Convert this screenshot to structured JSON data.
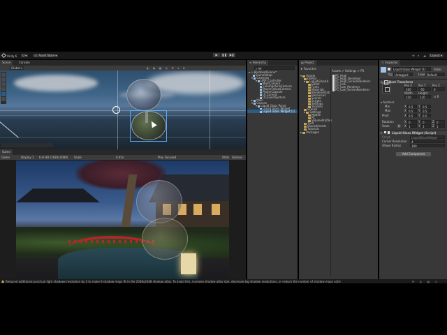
{
  "menubar": {
    "unity_label": "Unity 6",
    "account_label": "U",
    "asset_store_label": "Asset Store",
    "layout_label": "Layout"
  },
  "scene_view": {
    "tabs": [
      "Scene",
      "Console"
    ],
    "global_dropdown": "Global"
  },
  "game_view": {
    "tab": "Game",
    "toolbar": [
      "Game",
      "Display 1",
      "Full HD (1920x1080)",
      "Scale",
      "0.45x",
      "Play Focused",
      "Stats",
      "Gizmos"
    ]
  },
  "hierarchy": {
    "tab": "Hierarchy",
    "search_placeholder": "All",
    "items": [
      {
        "label": "BorderedScene*",
        "depth": 0,
        "kind": "scene"
      },
      {
        "label": "SceneSetup",
        "depth": 1,
        "kind": "go"
      },
      {
        "label": "Cameras",
        "depth": 1,
        "kind": "go"
      },
      {
        "label": "URP_Controller",
        "depth": 2,
        "kind": "go"
      },
      {
        "label": "MainCamera",
        "depth": 3,
        "kind": "go"
      },
      {
        "label": "CinemachineCamera",
        "depth": 3,
        "kind": "go"
      },
      {
        "label": "PlayerFollowCamera",
        "depth": 3,
        "kind": "go"
      },
      {
        "label": "PlayerCapsule",
        "depth": 3,
        "kind": "go"
      },
      {
        "label": "UI_Canvas",
        "depth": 3,
        "kind": "go"
      },
      {
        "label": "UI_EventSystem",
        "depth": 3,
        "kind": "go"
      },
      {
        "label": "Main",
        "depth": 1,
        "kind": "go"
      },
      {
        "label": "Canvas",
        "depth": 1,
        "kind": "go"
      },
      {
        "label": "Liquid Glass Panel",
        "depth": 2,
        "kind": "go"
      },
      {
        "label": "Liquid Glass Widget",
        "depth": 3,
        "kind": "go"
      },
      {
        "label": "Liquid Glass Widget (1)",
        "depth": 3,
        "kind": "go",
        "selected": true
      }
    ]
  },
  "project": {
    "tab": "Project",
    "favorites_label": "Favorites",
    "breadcrumb": "Assets > Settings > PS",
    "tree": [
      {
        "label": "Assets",
        "depth": 0
      },
      {
        "label": "DefVol",
        "depth": 1
      },
      {
        "label": "LiquidGlassUI",
        "depth": 1
      },
      {
        "label": "Editor",
        "depth": 2
      },
      {
        "label": "Fonts",
        "depth": 2
      },
      {
        "label": "Materials",
        "depth": 2
      },
      {
        "label": "RendererData",
        "depth": 2
      },
      {
        "label": "Resources",
        "depth": 2
      },
      {
        "label": "Scenes",
        "depth": 2
      },
      {
        "label": "Scripts",
        "depth": 2
      },
      {
        "label": "Settings",
        "depth": 2
      },
      {
        "label": "Shaders",
        "depth": 2
      },
      {
        "label": "Scenes",
        "depth": 1
      },
      {
        "label": "Settings",
        "depth": 1
      },
      {
        "label": "Mobile",
        "depth": 2
      },
      {
        "label": "PC",
        "depth": 2
      },
      {
        "label": "VolumeProfiles",
        "depth": 2
      },
      {
        "label": "TSUI",
        "depth": 1
      },
      {
        "label": "SharedAssets",
        "depth": 1
      },
      {
        "label": "Tutorials",
        "depth": 1
      },
      {
        "label": "Packages",
        "depth": 0
      }
    ],
    "files": [
      "PC_High",
      "PC_High_Renderer",
      "PC_High_ScreenRenderer",
      "PC_Low",
      "PC_Low_Renderer",
      "PC_Low_ScreenRenderer"
    ]
  },
  "inspector": {
    "tab": "Inspector",
    "object_name": "Liquid Glass Widget (1)",
    "static_label": "Static",
    "tag_label": "Tag",
    "tag_value": "Untagged",
    "layer_label": "Layer",
    "layer_value": "Default",
    "rect_transform": {
      "title": "Rect Transform",
      "anchor_preset": "center",
      "headers": [
        "Pos X",
        "Pos Y",
        "Pos Z"
      ],
      "pos": [
        "160",
        "-50",
        "0"
      ],
      "size_headers": [
        "Width",
        "Height"
      ],
      "size": [
        "120",
        "120"
      ],
      "anchors_label": "Anchors",
      "min_label": "Min",
      "min": [
        "0.5",
        "0.5"
      ],
      "max_label": "Max",
      "max": [
        "0.5",
        "0.5"
      ],
      "pivot_label": "Pivot",
      "pivot": [
        "0.5",
        "0.5"
      ],
      "rotation_label": "Rotation",
      "rotation": [
        "0",
        "0",
        "0"
      ],
      "scale_label": "Scale",
      "scale": [
        "1",
        "1",
        "1"
      ]
    },
    "widget": {
      "title": "Liquid Glass Widget (Script)",
      "script_label": "Script",
      "script_value": "LiquidGlassWidget",
      "corner_resolution_label": "Corner Resolution",
      "corner_resolution_value": "4",
      "shape_radius_label": "Shape Radius",
      "shape_radius_value": "300"
    },
    "add_component_label": "Add Component"
  },
  "statusbar": {
    "message": "Reduced additional punctual light shadows resolution by 2 to make 6 shadow maps fit in the 2048x2048 shadow atlas. To avoid this, increase shadow atlas size, decrease big shadow resolutions, or reduce the number of shadow maps active in the same frame"
  },
  "colors": {
    "accent": "#2c5d87",
    "panel": "#383838",
    "status_warning": "#e0c050"
  }
}
